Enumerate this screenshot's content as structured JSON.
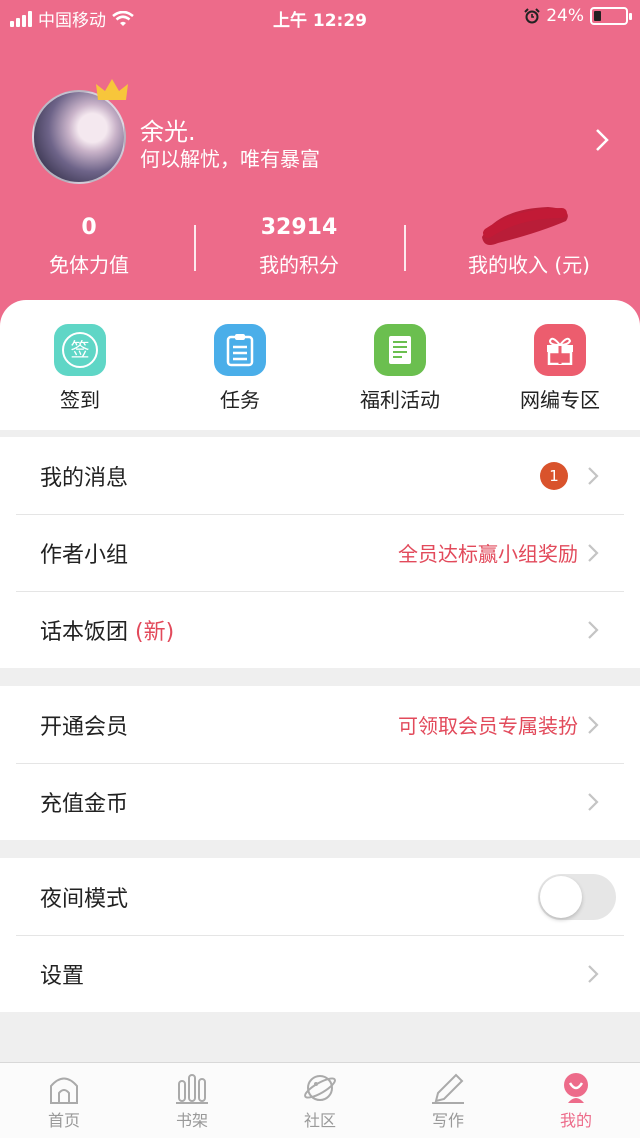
{
  "status_bar": {
    "carrier": "中国移动",
    "time": "上午 12:29",
    "battery": "24%",
    "battery_level": 0.24
  },
  "profile": {
    "name": "余光.",
    "signature": "何以解忧，唯有暴富"
  },
  "stats": [
    {
      "value": "0",
      "label": "免体力值"
    },
    {
      "value": "32914",
      "label": "我的积分"
    },
    {
      "value": "",
      "label": "我的收入 (元)"
    }
  ],
  "quick_actions": [
    {
      "label": "签到",
      "icon_glyph": "签",
      "icon": "sign-in-icon",
      "color": "#5fd6c6"
    },
    {
      "label": "任务",
      "icon": "task-list-icon",
      "color": "#4aaee9"
    },
    {
      "label": "福利活动",
      "icon": "document-icon",
      "color": "#6bbf4f"
    },
    {
      "label": "网编专区",
      "icon": "gift-icon",
      "color": "#ec5d6e"
    }
  ],
  "group1": {
    "messages": {
      "label": "我的消息",
      "badge": "1"
    },
    "author_group": {
      "label": "作者小组",
      "hint": "全员达标赢小组奖励"
    },
    "huaben": {
      "label": "话本饭团 ",
      "tag": "(新)"
    }
  },
  "group2": {
    "vip": {
      "label": "开通会员",
      "hint": "可领取会员专属装扮"
    },
    "recharge": {
      "label": "充值金币"
    }
  },
  "group3": {
    "night_mode": {
      "label": "夜间模式",
      "enabled": false
    },
    "settings": {
      "label": "设置"
    }
  },
  "tabbar": [
    {
      "label": "首页",
      "icon": "home-icon"
    },
    {
      "label": "书架",
      "icon": "bookshelf-icon"
    },
    {
      "label": "社区",
      "icon": "planet-icon"
    },
    {
      "label": "写作",
      "icon": "pen-icon"
    },
    {
      "label": "我的",
      "icon": "profile-icon",
      "active": true
    }
  ],
  "colors": {
    "brand": "#ed6b8a",
    "accent_text": "#e24a5b",
    "badge": "#d9532c"
  }
}
